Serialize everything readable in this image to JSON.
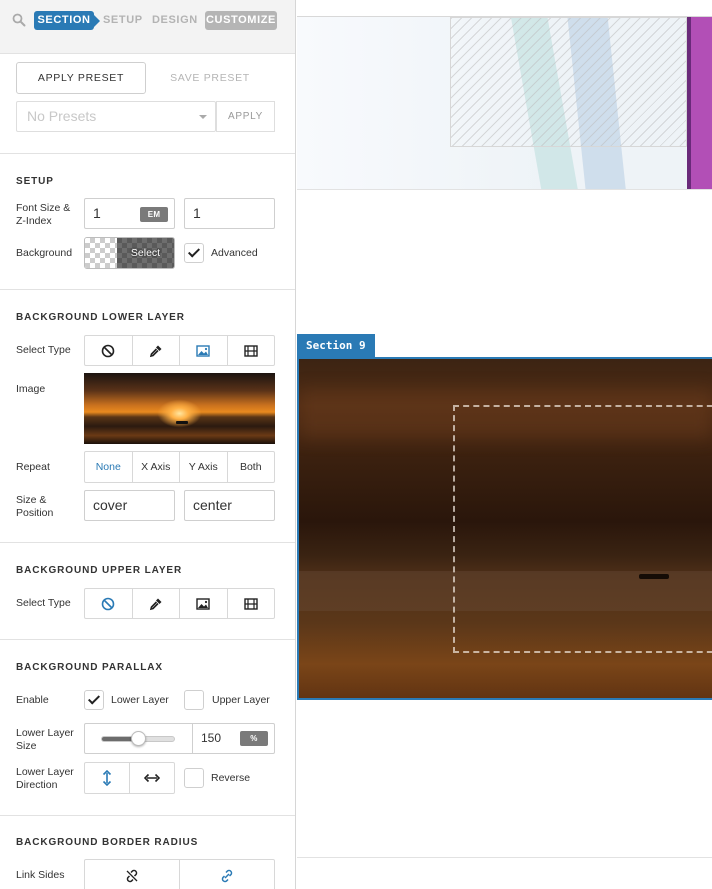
{
  "tabs": {
    "section": "SECTION",
    "setup": "SETUP",
    "design": "DESIGN",
    "customize": "CUSTOMIZE"
  },
  "presets": {
    "apply_preset": "APPLY PRESET",
    "save_preset": "SAVE PRESET",
    "select_value": "No Presets",
    "apply": "APPLY"
  },
  "setup": {
    "heading": "SETUP",
    "font_size_label": "Font Size & Z-Index",
    "font_size_value": "1",
    "font_size_unit": "EM",
    "z_index_value": "1",
    "background_label": "Background",
    "background_select": "Select",
    "advanced_label": "Advanced",
    "advanced_checked": true
  },
  "lower_layer": {
    "heading": "BACKGROUND LOWER LAYER",
    "select_type_label": "Select Type",
    "active_type": "image",
    "image_label": "Image",
    "repeat_label": "Repeat",
    "repeat_options": [
      "None",
      "X Axis",
      "Y Axis",
      "Both"
    ],
    "repeat_active": "None",
    "size_position_label": "Size & Position",
    "size_value": "cover",
    "position_value": "center"
  },
  "upper_layer": {
    "heading": "BACKGROUND UPPER LAYER",
    "select_type_label": "Select Type",
    "active_type": "none"
  },
  "parallax": {
    "heading": "BACKGROUND PARALLAX",
    "enable_label": "Enable",
    "lower_layer_label": "Lower Layer",
    "lower_layer_checked": true,
    "upper_layer_label": "Upper Layer",
    "upper_layer_checked": false,
    "size_label": "Lower Layer Size",
    "size_value": "150",
    "size_unit": "%",
    "slider_fraction": 0.5,
    "direction_label": "Lower Layer Direction",
    "reverse_label": "Reverse",
    "reverse_checked": false
  },
  "border_radius": {
    "heading": "BACKGROUND BORDER RADIUS",
    "link_sides_label": "Link Sides"
  },
  "canvas": {
    "section_tag": "Section 9"
  },
  "colors": {
    "accent": "#2a7ab5",
    "active_tab_bg": "#2a7ab5",
    "customize_tab_bg": "#b5b5b5",
    "purple_bar": "#b24fb6"
  }
}
